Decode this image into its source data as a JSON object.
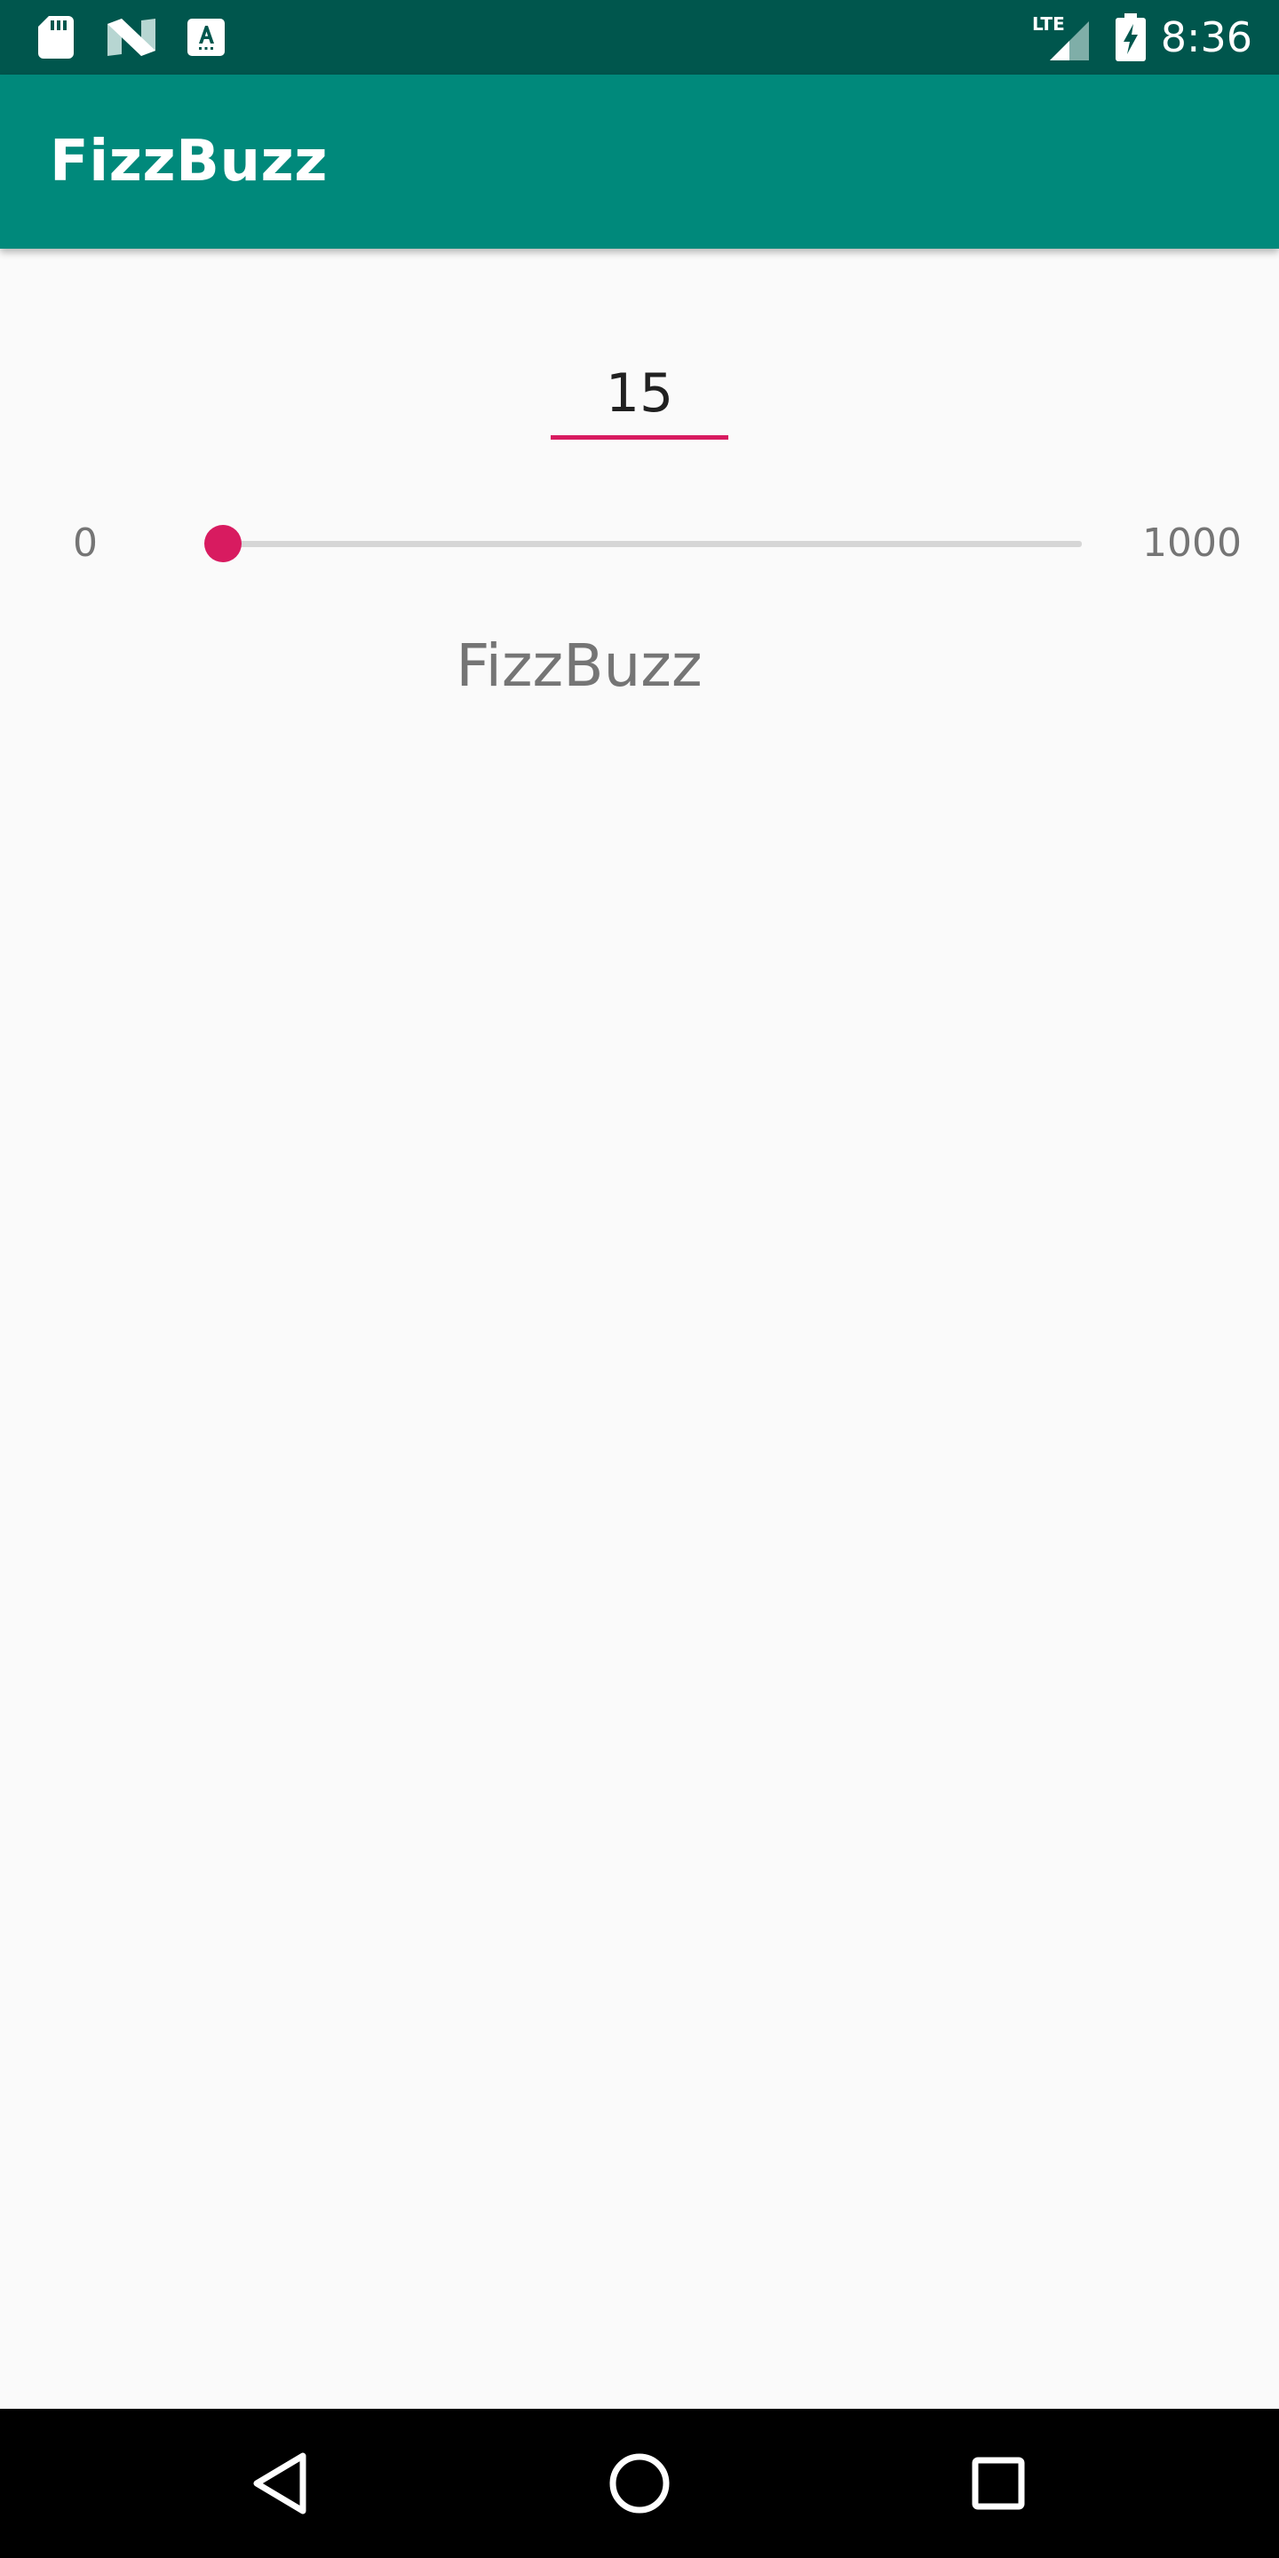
{
  "status_bar": {
    "time": "8:36",
    "network": "LTE",
    "icons": [
      "sd-card-icon",
      "n-logo-icon",
      "a-keyboard-icon",
      "lte-signal-icon",
      "battery-charging-icon"
    ]
  },
  "app_bar": {
    "title": "FizzBuzz"
  },
  "number_input": {
    "value": "15"
  },
  "slider": {
    "min_label": "0",
    "max_label": "1000",
    "min": 0,
    "max": 1000,
    "value": 15
  },
  "result": {
    "text": "FizzBuzz"
  },
  "nav_bar": {
    "buttons": [
      "back-icon",
      "home-icon",
      "recents-icon"
    ]
  },
  "colors": {
    "status_bar": "#00564D",
    "app_bar": "#00897B",
    "accent": "#D81B60",
    "background": "#FAFAFA",
    "secondary_text": "#757575"
  }
}
